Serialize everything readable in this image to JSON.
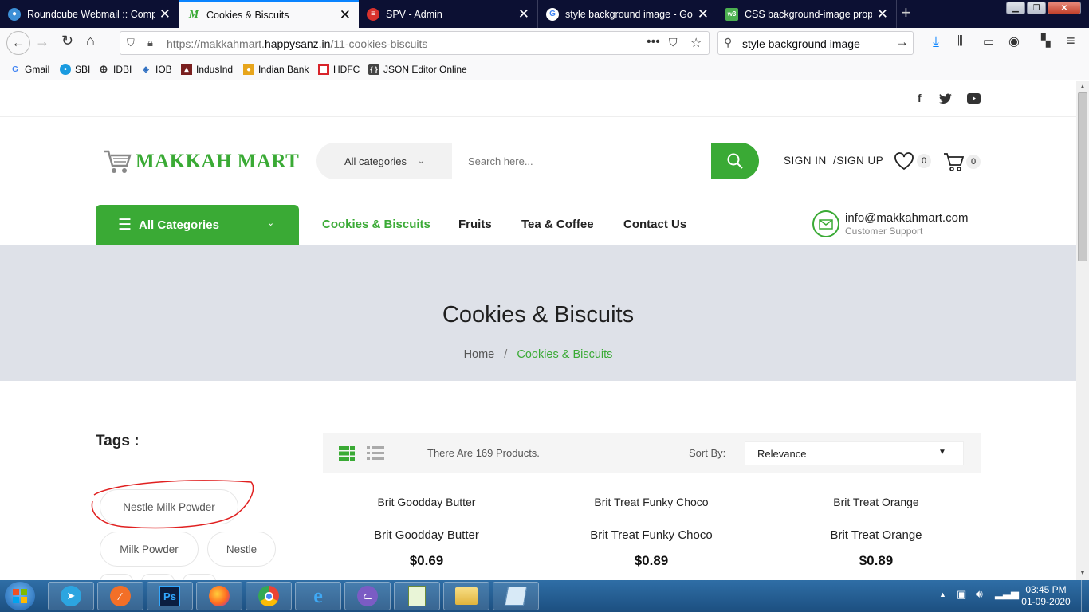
{
  "browser": {
    "tabs": [
      {
        "title": "Roundcube Webmail :: Compo",
        "icon": "roundcube-icon"
      },
      {
        "title": "Cookies & Biscuits",
        "icon": "makkah-mart-icon",
        "active": true
      },
      {
        "title": "SPV - Admin",
        "icon": "spv-icon"
      },
      {
        "title": "style background image - Goo",
        "icon": "google-icon"
      },
      {
        "title": "CSS background-image proper",
        "icon": "w3schools-icon"
      }
    ],
    "url_prefix": "https://makkahmart.",
    "url_domain": "happysanz.in",
    "url_path": "/11-cookies-biscuits",
    "search_value": "style background image",
    "bookmarks": [
      "Gmail",
      "SBI",
      "IDBI",
      "IOB",
      "IndusInd",
      "Indian Bank",
      "HDFC",
      "JSON Editor Online"
    ]
  },
  "site": {
    "logo_text": "MAKKAH MART",
    "search": {
      "category_label": "All categories",
      "placeholder": "Search here..."
    },
    "sign_in": "SIGN IN",
    "sign_up": "/SIGN UP",
    "wishlist_count": "0",
    "cart_count": "0",
    "all_categories": "All Categories",
    "menu": [
      "Cookies & Biscuits",
      "Fruits",
      "Tea & Coffee",
      "Contact Us"
    ],
    "contact_email": "info@makkahmart.com",
    "contact_sub": "Customer Support",
    "accent_color": "#3aaa35"
  },
  "banner": {
    "title": "Cookies & Biscuits",
    "breadcrumb_home": "Home",
    "breadcrumb_sep": "/",
    "breadcrumb_current": "Cookies & Biscuits"
  },
  "sidebar": {
    "tags_title": "Tags :",
    "tags": [
      "Nestle Milk Powder",
      "Milk Powder",
      "Nestle"
    ]
  },
  "toolbar": {
    "count_text": "There Are 169 Products.",
    "sort_label": "Sort By:",
    "sort_value": "Relevance"
  },
  "products": [
    {
      "name_top": "Brit Goodday Butter",
      "name": "Brit Goodday Butter",
      "price": "$0.69"
    },
    {
      "name_top": "Brit Treat Funky Choco",
      "name": "Brit Treat Funky Choco",
      "price": "$0.89"
    },
    {
      "name_top": "Brit Treat Orange",
      "name": "Brit Treat Orange",
      "price": "$0.89"
    }
  ],
  "taskbar": {
    "time": "03:45 PM",
    "date": "01-09-2020",
    "apps": [
      "telegram-icon",
      "brave-icon",
      "photoshop-icon",
      "firefox-icon",
      "chrome-icon",
      "ie-icon",
      "cat-app-icon",
      "notepad-app-icon",
      "file-explorer-icon",
      "pencil-app-icon"
    ]
  }
}
